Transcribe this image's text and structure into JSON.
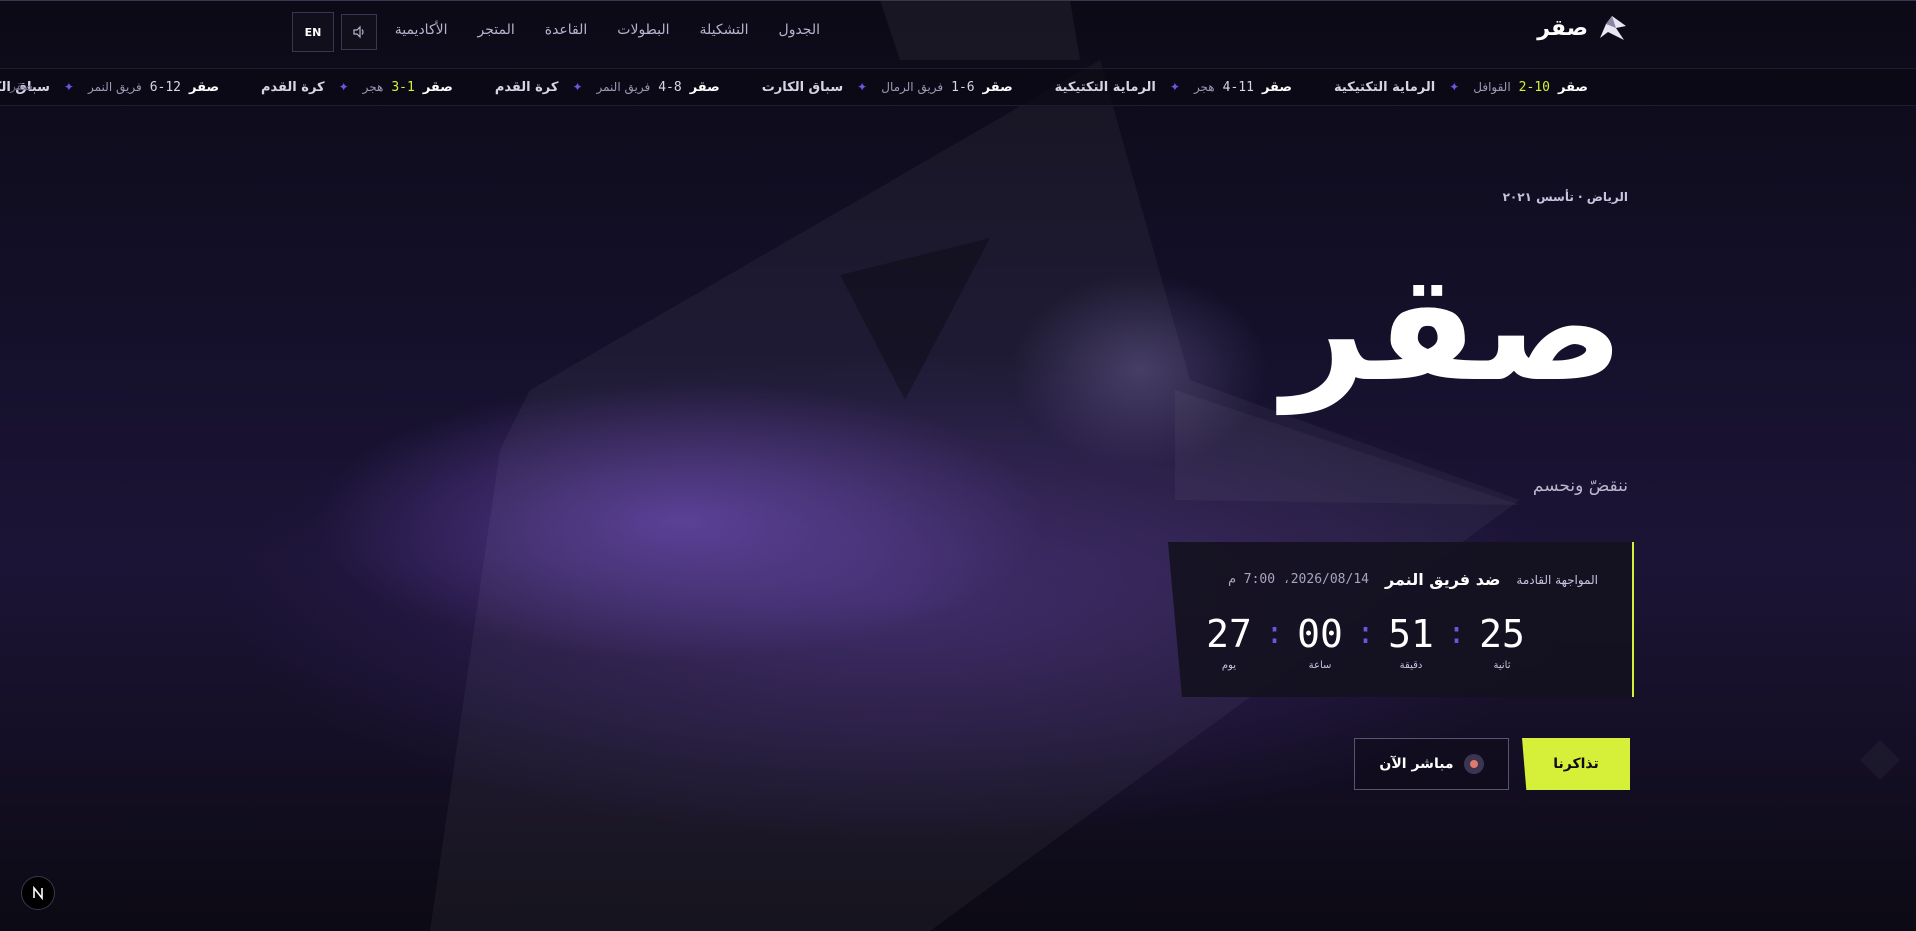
{
  "brand": {
    "name": "صقر",
    "logo_icon": "falcon-logo-icon"
  },
  "nav": {
    "links": [
      "الجدول",
      "التشكيلة",
      "البطولات",
      "القاعدة",
      "المتجر",
      "الأكاديمية"
    ],
    "sound_icon": "speaker-icon",
    "lang_label": "EN"
  },
  "ticker": {
    "items": [
      {
        "team": "صقر",
        "score": "2-10",
        "highlight": true,
        "opponent": "القوافل",
        "game": "الرماية التكتيكية"
      },
      {
        "team": "صقر",
        "score": "4-11",
        "highlight": false,
        "opponent": "هجر",
        "game": "الرماية التكتيكية"
      },
      {
        "team": "صقر",
        "score": "1-6",
        "highlight": false,
        "opponent": "فريق الرمال",
        "game": "سباق الكارت"
      },
      {
        "team": "صقر",
        "score": "4-8",
        "highlight": false,
        "opponent": "فريق النمر",
        "game": "كرة القدم"
      },
      {
        "team": "صقر",
        "score": "3-1",
        "highlight": true,
        "opponent": "هجر",
        "game": "كرة القدم"
      },
      {
        "team": "صقر",
        "score": "6-12",
        "highlight": false,
        "opponent": "فريق النمر",
        "game": "سباق الكارت"
      }
    ],
    "tail": "صقر"
  },
  "hero": {
    "eyebrow": "الرياض · تأسس ٢٠٢١",
    "title": "صقر",
    "tagline": "ننقضّ ونحسم"
  },
  "match": {
    "label": "المواجهة القادمة",
    "opponent": "ضد فريق النمر",
    "datetime": "2026/08/14، 7:00 م",
    "countdown": [
      {
        "value": "27",
        "unit": "يوم"
      },
      {
        "value": "00",
        "unit": "ساعة"
      },
      {
        "value": "51",
        "unit": "دقيقة"
      },
      {
        "value": "25",
        "unit": "ثانية"
      }
    ],
    "accent": "#d6f03a"
  },
  "cta": {
    "tickets": "تذاكرنا",
    "live": "مباشر الآن"
  },
  "colors": {
    "accent": "#d6f03a",
    "purple": "#6b56e0",
    "bg": "#0d0b17"
  },
  "badge": {
    "letter": "N"
  }
}
